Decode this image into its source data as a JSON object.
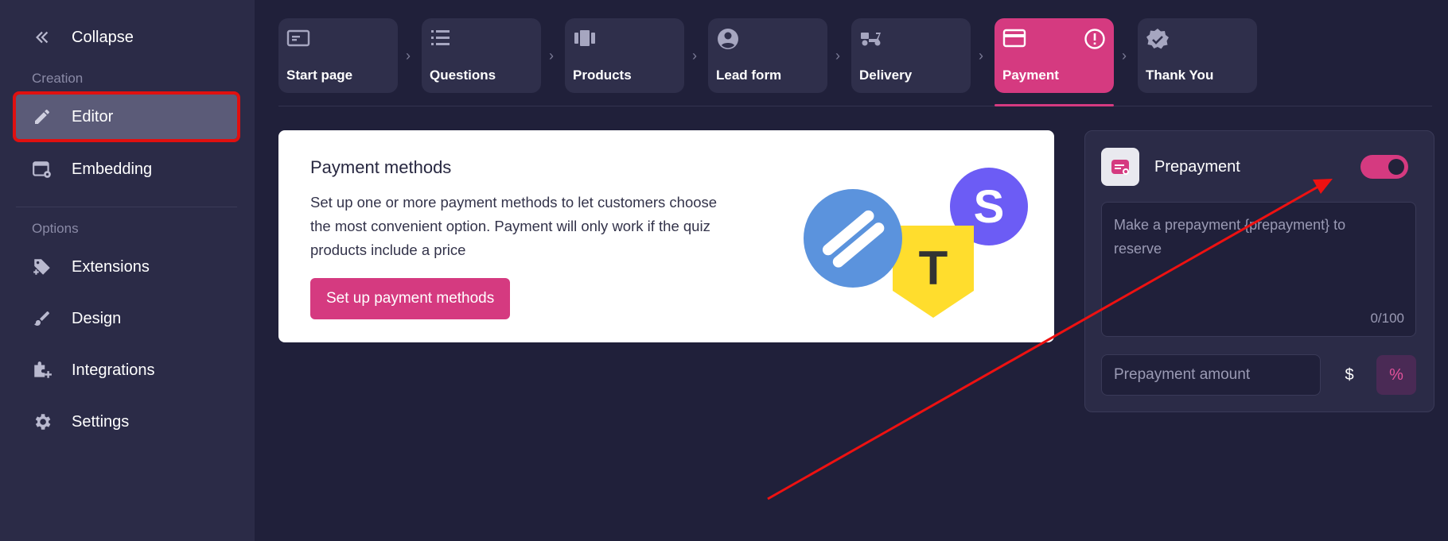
{
  "sidebar": {
    "collapse_label": "Collapse",
    "section_creation": "Creation",
    "section_options": "Options",
    "items": [
      {
        "label": "Editor",
        "icon": "pencil-icon"
      },
      {
        "label": "Embedding",
        "icon": "embed-window-icon"
      },
      {
        "label": "Extensions",
        "icon": "puzzle-icon"
      },
      {
        "label": "Design",
        "icon": "brush-icon"
      },
      {
        "label": "Integrations",
        "icon": "integration-plus-icon"
      },
      {
        "label": "Settings",
        "icon": "gear-icon"
      }
    ]
  },
  "steps": [
    {
      "label": "Start page",
      "icon": "page-icon"
    },
    {
      "label": "Questions",
      "icon": "list-icon"
    },
    {
      "label": "Products",
      "icon": "products-icon"
    },
    {
      "label": "Lead form",
      "icon": "user-circle-icon"
    },
    {
      "label": "Delivery",
      "icon": "scooter-icon"
    },
    {
      "label": "Payment",
      "icon": "card-icon"
    },
    {
      "label": "Thank You",
      "icon": "verified-badge-icon"
    }
  ],
  "payment_card": {
    "title": "Payment methods",
    "description": "Set up one or more payment methods to let customers choose the most convenient option. Payment will only work if the quiz products include a price",
    "button_label": "Set up payment methods",
    "logo_letter_s": "S",
    "logo_letter_t": "T"
  },
  "prepayment": {
    "title": "Prepayment",
    "toggle_on": true,
    "message_text": "Make a prepayment {prepayment} to reserve",
    "char_count": "0/100",
    "amount_placeholder": "Prepayment amount",
    "currency_symbol": "$",
    "percent_symbol": "%"
  },
  "colors": {
    "accent": "#d53a80",
    "background": "#20203a",
    "sidebar": "#2b2b47",
    "highlight_box": "#e01010"
  }
}
